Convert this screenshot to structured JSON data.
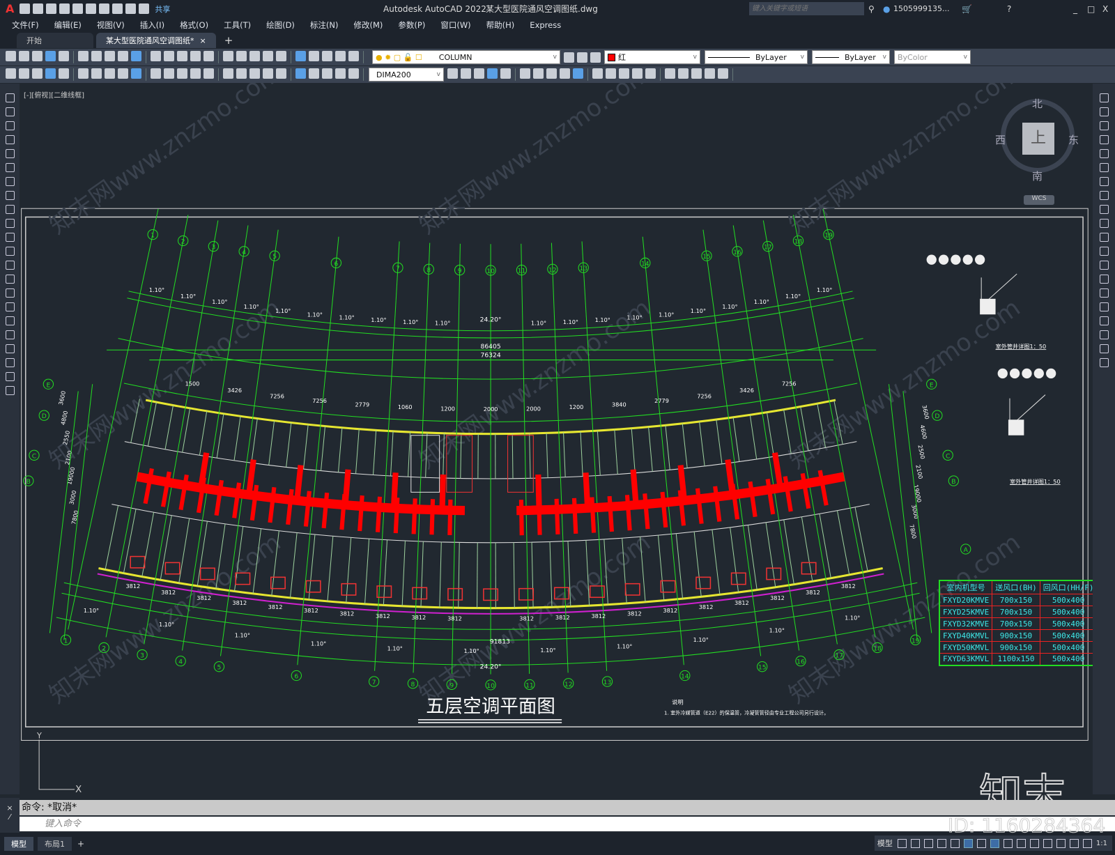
{
  "app": {
    "title": "Autodesk AutoCAD 2022",
    "file": "某大型医院通风空调图纸.dwg",
    "share": "共享",
    "search_placeholder": "键入关键字或短语",
    "user": "1505999135...",
    "quick_icons": [
      "new-icon",
      "open-icon",
      "save-icon",
      "saveas-icon",
      "web-mobile-open-icon",
      "web-mobile-save-icon",
      "plot-icon",
      "undo-icon",
      "redo-icon",
      "customize-icon"
    ]
  },
  "menu": [
    "文件(F)",
    "编辑(E)",
    "视图(V)",
    "插入(I)",
    "格式(O)",
    "工具(T)",
    "绘图(D)",
    "标注(N)",
    "修改(M)",
    "参数(P)",
    "窗口(W)",
    "帮助(H)",
    "Express"
  ],
  "tabs": [
    {
      "label": "开始"
    },
    {
      "label": "某大型医院通风空调图纸*"
    }
  ],
  "toolbar": {
    "layer": "COLUMN",
    "color": "红",
    "color_hex": "#ff0000",
    "linetype": "ByLayer",
    "lineweight": "ByLayer",
    "plotstyle": "ByColor",
    "dimstyle": "DIMA200"
  },
  "viewport": {
    "label": "[-][俯视][二维线框]"
  },
  "viewcube": {
    "north": "北",
    "south": "南",
    "west": "西",
    "east": "东",
    "top": "上",
    "wcs": "WCS"
  },
  "ucs": {
    "x": "X",
    "y": "Y"
  },
  "drawing": {
    "title": "五层空调平面图",
    "axes_top": [
      "1",
      "2",
      "3",
      "4",
      "5",
      "6",
      "7",
      "8",
      "9",
      "10",
      "11",
      "12",
      "13",
      "14",
      "15",
      "16",
      "17",
      "18",
      "19"
    ],
    "row_axes_left": [
      "E",
      "D",
      "C",
      "B"
    ],
    "row_axes_right": [
      "E",
      "D",
      "C",
      "B",
      "A"
    ],
    "angle_step": "1.10°",
    "total_angle": "24.20°",
    "dims_top": [
      "86405",
      "76324"
    ],
    "dims_mid": [
      "1500",
      "3426",
      "7256",
      "7256",
      "2779",
      "1060",
      "1200",
      "2000",
      "2000",
      "1200",
      "3840",
      "2779",
      "7256",
      "3426",
      "7256"
    ],
    "dims_left": [
      "3600",
      "4800",
      "2550",
      "2100",
      "19000",
      "3000",
      "7800"
    ],
    "dims_right": [
      "3600",
      "4600",
      "2500",
      "2100",
      "19000",
      "3000",
      "7800"
    ],
    "dims_bottom_repeat": "3812",
    "dim_bottom_total": "91813",
    "note_title": "说明",
    "note_text": "1. 室外冷媒管道（E22）的保温管，冷凝管管径由专业工程公司另行设计。",
    "detail_titles": [
      "室外管井详图1：50",
      "室外管井详图1：50"
    ],
    "colors": {
      "grid": "#22dd22",
      "duct": "#ff0000",
      "wall": "#e6e630",
      "dim": "#22dd22",
      "text": "#3ee8e8"
    }
  },
  "equipment_table": {
    "headers": [
      "室内机型号",
      "送风口(BH)",
      "回风口(HH/F)"
    ],
    "rows": [
      [
        "FXYD20KMVE",
        "700x150",
        "500x400"
      ],
      [
        "FXYD25KMVE",
        "700x150",
        "500x400"
      ],
      [
        "FXYD32KMVE",
        "700x150",
        "500x400"
      ],
      [
        "FXYD40KMVL",
        "900x150",
        "500x400"
      ],
      [
        "FXYD50KMVL",
        "900x150",
        "500x400"
      ],
      [
        "FXYD63KMVL",
        "1100x150",
        "500x400"
      ]
    ]
  },
  "command": {
    "history": "命令: *取消*",
    "placeholder": "键入命令"
  },
  "layout_tabs": [
    "模型",
    "布局1"
  ],
  "status": {
    "model": "模型",
    "scale": "1:1"
  },
  "watermark": {
    "text": "知末网www.znzmo.com",
    "logo": "知末",
    "id": "ID: 1160284364"
  }
}
